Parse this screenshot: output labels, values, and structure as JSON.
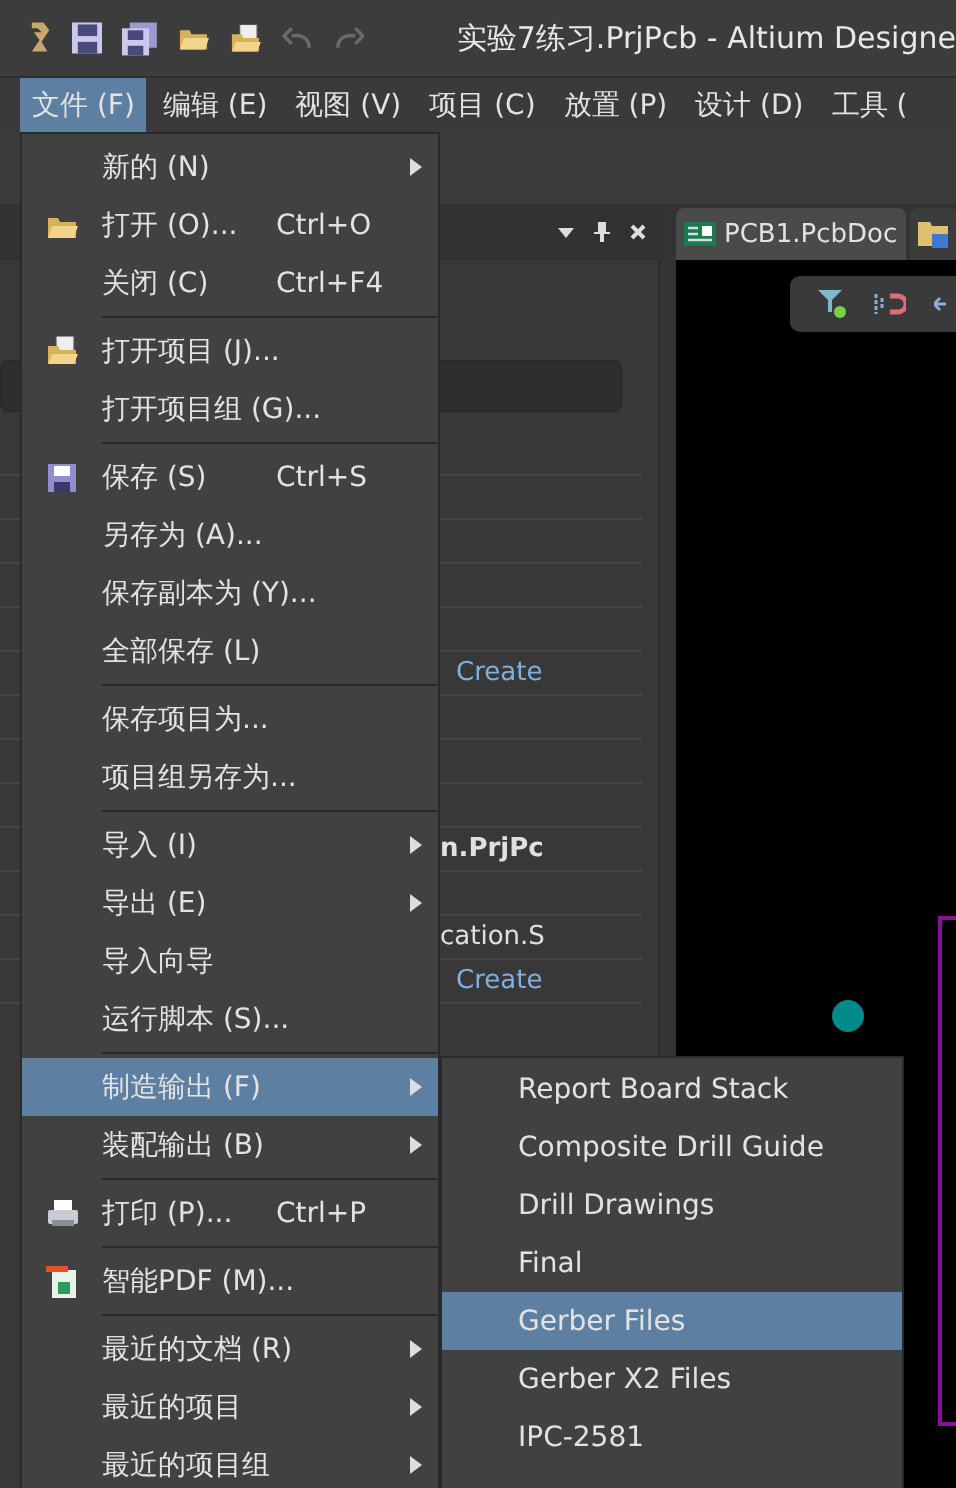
{
  "window": {
    "title": "实验7练习.PrjPcb - Altium Designe"
  },
  "menubar": [
    {
      "label": "文件 (F)",
      "selected": true
    },
    {
      "label": "编辑 (E)",
      "selected": false
    },
    {
      "label": "视图 (V)",
      "selected": false
    },
    {
      "label": "项目 (C)",
      "selected": false
    },
    {
      "label": "放置 (P)",
      "selected": false
    },
    {
      "label": "设计 (D)",
      "selected": false
    },
    {
      "label": "工具 (",
      "selected": false
    }
  ],
  "panel": {
    "items": [
      {
        "text": "Create",
        "kind": "link"
      },
      {
        "text": "n.PrjPc",
        "kind": "bold"
      },
      {
        "text": "cation.S",
        "kind": "plain"
      },
      {
        "text": "Create",
        "kind": "link"
      }
    ]
  },
  "document_tabs": [
    {
      "label": "PCB1.PcbDoc",
      "selected": true
    },
    {
      "selected": false
    }
  ],
  "file_menu": [
    {
      "kind": "item",
      "label": "新的 (N)",
      "submenu": true,
      "selected": false
    },
    {
      "kind": "item",
      "label": "打开 (O)...",
      "shortcut": "Ctrl+O",
      "selected": false
    },
    {
      "kind": "item",
      "label": "关闭 (C)",
      "shortcut": "Ctrl+F4",
      "selected": false
    },
    {
      "kind": "separator"
    },
    {
      "kind": "item",
      "label": "打开项目 (J)...",
      "selected": false
    },
    {
      "kind": "item",
      "label": "打开项目组 (G)...",
      "selected": false
    },
    {
      "kind": "separator"
    },
    {
      "kind": "item",
      "label": "保存 (S)",
      "shortcut": "Ctrl+S",
      "selected": false
    },
    {
      "kind": "item",
      "label": "另存为 (A)...",
      "selected": false
    },
    {
      "kind": "item",
      "label": "保存副本为 (Y)...",
      "selected": false
    },
    {
      "kind": "item",
      "label": "全部保存 (L)",
      "selected": false
    },
    {
      "kind": "separator"
    },
    {
      "kind": "item",
      "label": "保存项目为...",
      "selected": false
    },
    {
      "kind": "item",
      "label": "项目组另存为...",
      "selected": false
    },
    {
      "kind": "separator"
    },
    {
      "kind": "item",
      "label": "导入 (I)",
      "submenu": true,
      "selected": false
    },
    {
      "kind": "item",
      "label": "导出 (E)",
      "submenu": true,
      "selected": false
    },
    {
      "kind": "item",
      "label": "导入向导",
      "selected": false
    },
    {
      "kind": "item",
      "label": "运行脚本 (S)...",
      "selected": false
    },
    {
      "kind": "separator"
    },
    {
      "kind": "item",
      "label": "制造输出 (F)",
      "submenu": true,
      "selected": true
    },
    {
      "kind": "item",
      "label": "装配输出 (B)",
      "submenu": true,
      "selected": false
    },
    {
      "kind": "separator"
    },
    {
      "kind": "item",
      "label": "打印 (P)...",
      "shortcut": "Ctrl+P",
      "selected": false
    },
    {
      "kind": "separator"
    },
    {
      "kind": "item",
      "label": "智能PDF (M)...",
      "selected": false
    },
    {
      "kind": "separator"
    },
    {
      "kind": "item",
      "label": "最近的文档 (R)",
      "submenu": true,
      "selected": false
    },
    {
      "kind": "item",
      "label": "最近的项目",
      "submenu": true,
      "selected": false
    },
    {
      "kind": "item",
      "label": "最近的项目组",
      "submenu": true,
      "selected": false
    }
  ],
  "fabrication_submenu": [
    {
      "label": "Report Board Stack",
      "selected": false
    },
    {
      "label": "Composite Drill Guide",
      "selected": false
    },
    {
      "label": "Drill Drawings",
      "selected": false
    },
    {
      "label": "Final",
      "selected": false
    },
    {
      "label": "Gerber Files",
      "selected": true
    },
    {
      "label": "Gerber X2 Files",
      "selected": false
    },
    {
      "label": "IPC-2581",
      "selected": false
    }
  ]
}
